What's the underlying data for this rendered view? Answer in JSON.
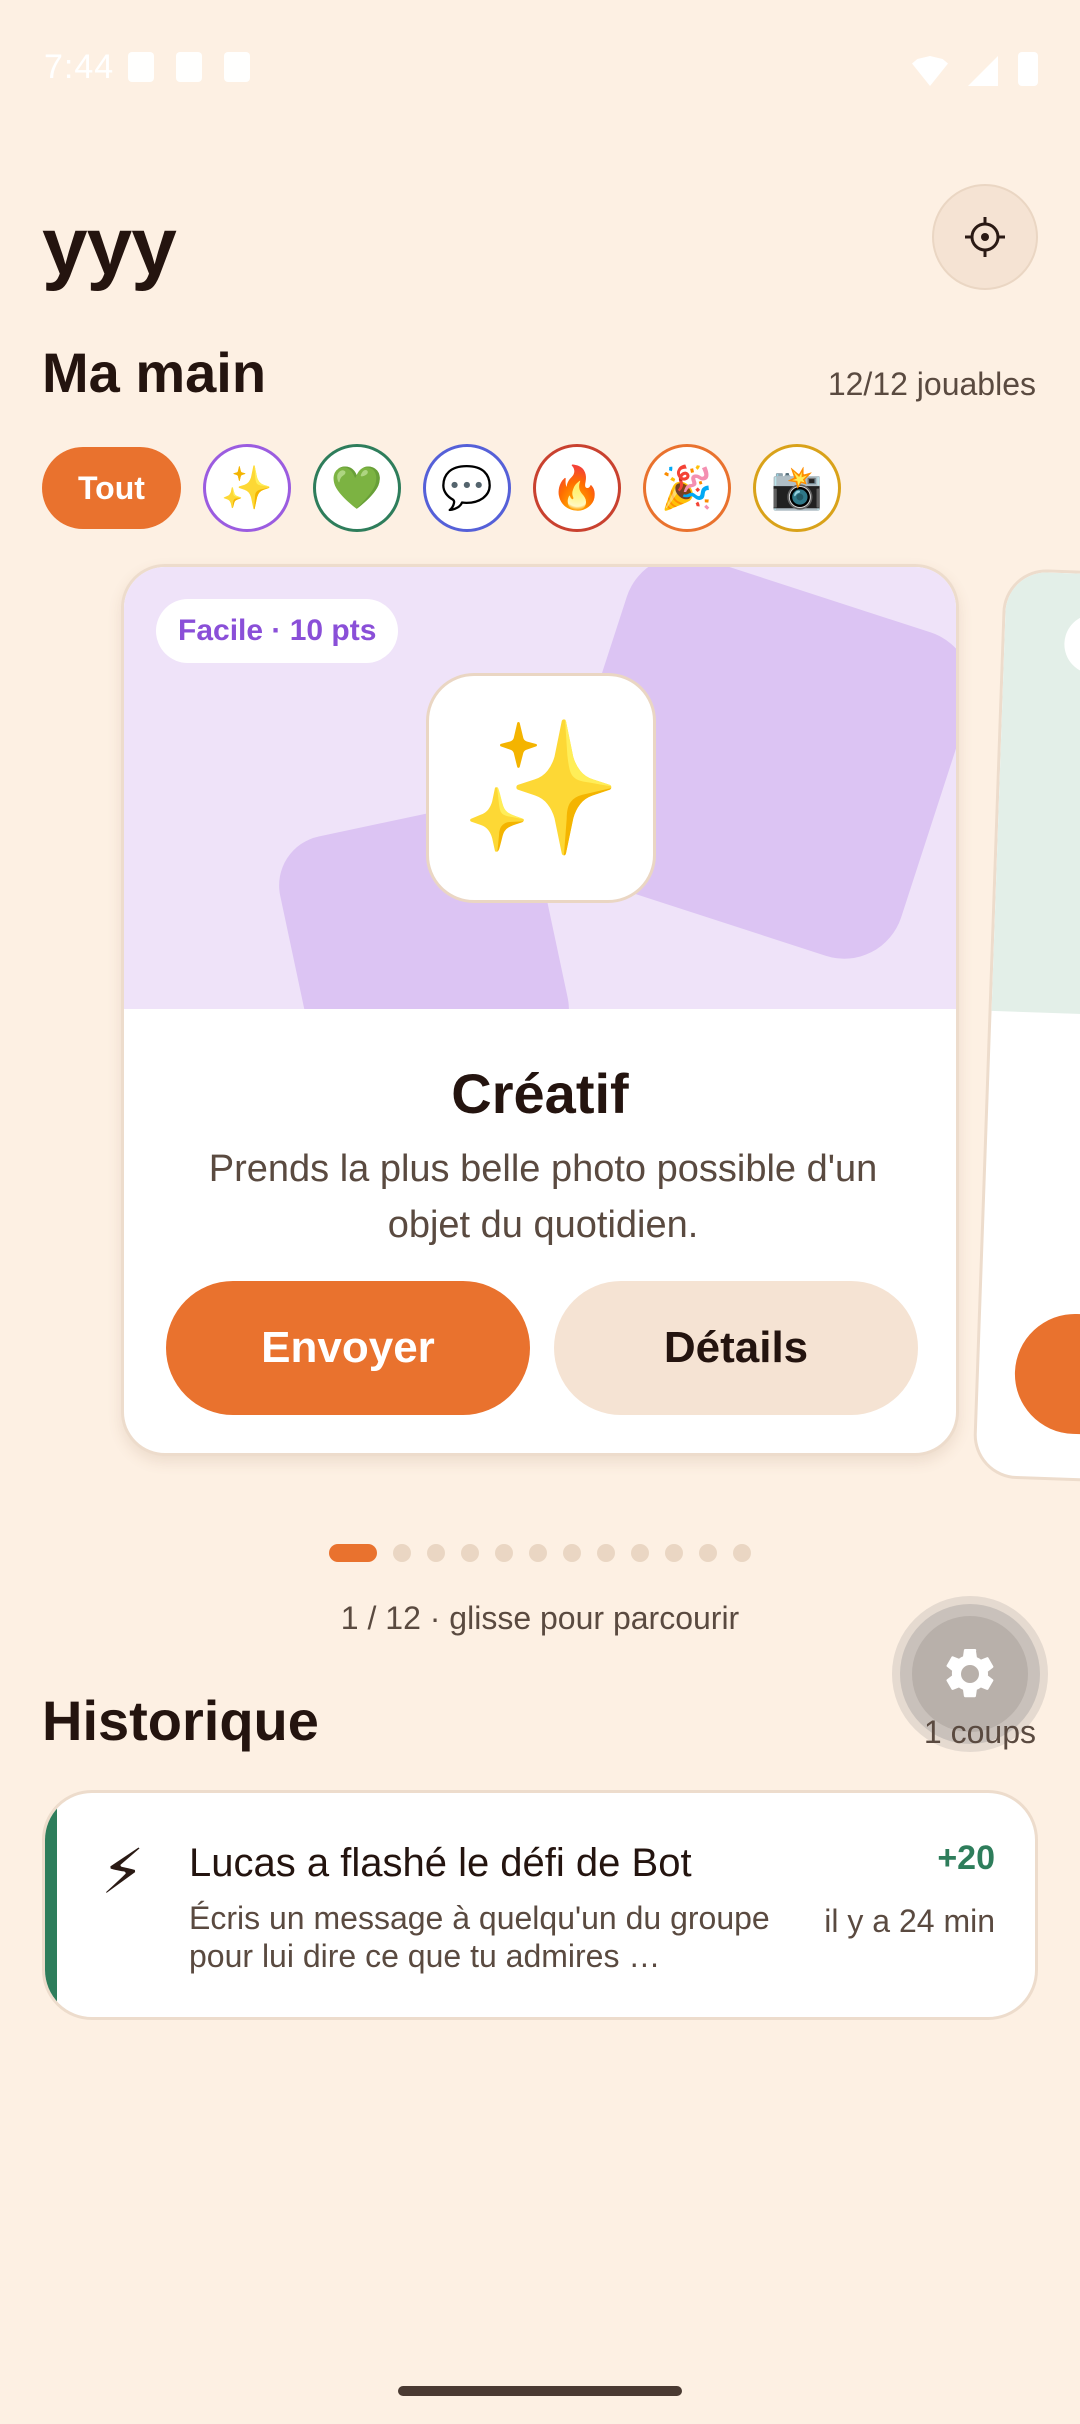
{
  "status_bar": {
    "time": "7:44"
  },
  "header": {
    "title": "yyy",
    "target_icon": "target-icon"
  },
  "hand": {
    "title": "Ma main",
    "count": "12/12 jouables",
    "filters": {
      "all_label": "Tout",
      "chips": [
        {
          "emoji": "✨",
          "icon": "sparkles-icon",
          "color": "#9b5ce0"
        },
        {
          "emoji": "💚",
          "icon": "green-heart-icon",
          "color": "#2e7d5b"
        },
        {
          "emoji": "💬",
          "icon": "speech-bubble-icon",
          "color": "#5560d8"
        },
        {
          "emoji": "🔥",
          "icon": "fire-icon",
          "color": "#c9412f"
        },
        {
          "emoji": "🎉",
          "icon": "party-popper-icon",
          "color": "#e9722e"
        },
        {
          "emoji": "📸",
          "icon": "camera-flash-icon",
          "color": "#d9a21a"
        }
      ]
    }
  },
  "card": {
    "badge": "Facile · 10 pts",
    "emoji": "✨",
    "title": "Créatif",
    "description": "Prends la plus belle photo possible d'un objet du quotidien.",
    "send_label": "Envoyer",
    "details_label": "Détails"
  },
  "carousel": {
    "total": 12,
    "active_index": 0,
    "hint": "1 / 12 · glisse pour parcourir"
  },
  "history": {
    "title": "Historique",
    "count": "1 coups",
    "items": [
      {
        "emoji": "⚡",
        "title": "Lucas a flashé le défi de Bot",
        "description": "Écris un message à quelqu'un du groupe pour lui dire ce que tu admires …",
        "points": "+20",
        "time": "il y a 24 min"
      }
    ]
  },
  "colors": {
    "accent": "#e9722e",
    "background": "#fdf0e3",
    "success": "#2e7d5b",
    "card_art": "#efe3f9"
  }
}
